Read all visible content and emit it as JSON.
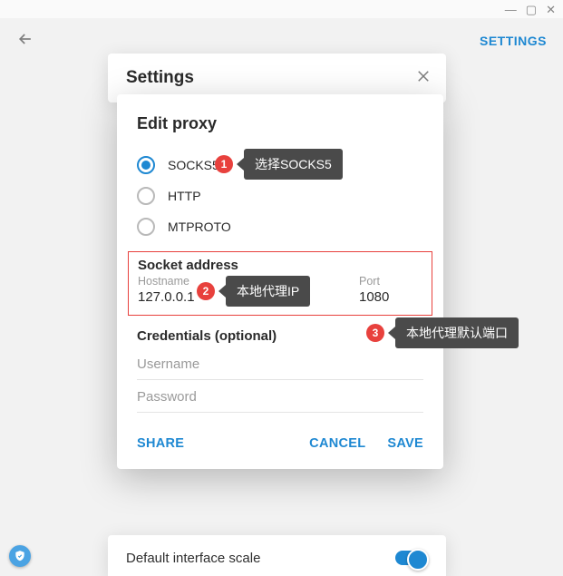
{
  "titlebar": {
    "minimize": "—",
    "maximize": "▢",
    "close": "✕"
  },
  "header": {
    "settings_link": "SETTINGS"
  },
  "settings_panel": {
    "title": "Settings"
  },
  "bottom_panel": {
    "label": "Default interface scale"
  },
  "dialog": {
    "title": "Edit proxy",
    "proxy_types": [
      {
        "label": "SOCKS5",
        "checked": true
      },
      {
        "label": "HTTP",
        "checked": false
      },
      {
        "label": "MTPROTO",
        "checked": false
      }
    ],
    "socket_section": "Socket address",
    "hostname_label": "Hostname",
    "hostname_value": "127.0.0.1",
    "port_label": "Port",
    "port_value": "1080",
    "credentials_section": "Credentials (optional)",
    "username_placeholder": "Username",
    "password_placeholder": "Password",
    "share": "SHARE",
    "cancel": "CANCEL",
    "save": "SAVE"
  },
  "annotations": {
    "1": {
      "num": "1",
      "text": "选择SOCKS5"
    },
    "2": {
      "num": "2",
      "text": "本地代理IP"
    },
    "3": {
      "num": "3",
      "text": "本地代理默认端口"
    }
  }
}
